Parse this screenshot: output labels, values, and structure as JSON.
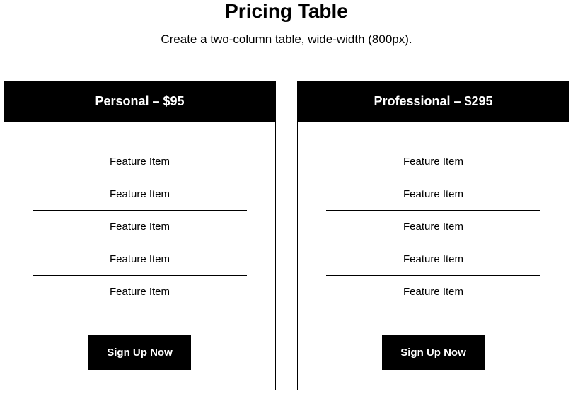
{
  "header": {
    "title": "Pricing Table",
    "subtitle": "Create a two-column table, wide-width (800px)."
  },
  "plans": [
    {
      "name": "Personal – $95",
      "features": [
        "Feature Item",
        "Feature Item",
        "Feature Item",
        "Feature Item",
        "Feature Item"
      ],
      "cta": "Sign Up Now"
    },
    {
      "name": "Professional – $295",
      "features": [
        "Feature Item",
        "Feature Item",
        "Feature Item",
        "Feature Item",
        "Feature Item"
      ],
      "cta": "Sign Up Now"
    }
  ]
}
